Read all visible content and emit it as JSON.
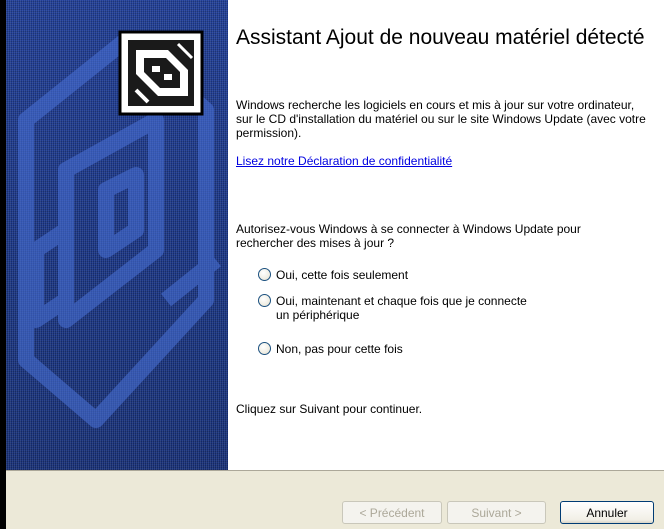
{
  "wizard": {
    "title": "Assistant Ajout de nouveau matériel détecté",
    "intro": "Windows recherche les logiciels en cours et mis à jour sur votre ordinateur, sur le CD d'installation du matériel ou sur le site Windows Update (avec votre permission).",
    "privacy_link": "Lisez notre Déclaration de confidentialité",
    "question": "Autorisez-vous Windows à se connecter à Windows Update pour rechercher des mises à jour ?",
    "options": [
      {
        "label": "Oui, cette fois seulement",
        "checked": false
      },
      {
        "label": "Oui, maintenant et chaque fois que je connecte",
        "label2": "un périphérique",
        "checked": false
      },
      {
        "label": "Non, pas pour cette fois",
        "checked": false
      }
    ],
    "continue_text": "Cliquez sur Suivant pour continuer."
  },
  "buttons": {
    "back": "< Précédent",
    "next": "Suivant >",
    "cancel": "Annuler"
  },
  "colors": {
    "banner": "#1c3a8c",
    "link": "#0000e0",
    "footer": "#ece9d8"
  },
  "icons": {
    "banner_icon": "hardware-card-icon"
  }
}
